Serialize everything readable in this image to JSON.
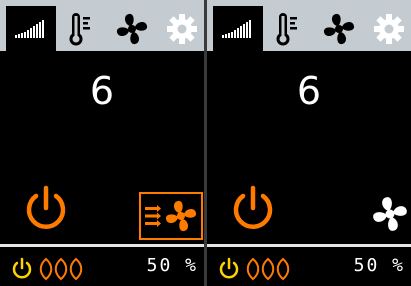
{
  "colors": {
    "accent": "#ff7b00",
    "status_yellow": "#ffd200",
    "tabbar_bg": "#c4ccd2",
    "screen_bg": "#000000"
  },
  "panels": [
    {
      "tabs": [
        {
          "icon": "signal-bars-icon",
          "active": true
        },
        {
          "icon": "thermometer-icon",
          "active": false
        },
        {
          "icon": "fan-icon",
          "active": false
        },
        {
          "icon": "gear-icon",
          "active": false
        }
      ],
      "value": "6",
      "mode_button_icon": "fan-airflow-icon",
      "status": {
        "power_icon": "power-icon",
        "heat_icon": "heat-waves-icon",
        "percent_value": "50",
        "percent_unit": "%"
      }
    },
    {
      "tabs": [
        {
          "icon": "signal-bars-icon",
          "active": true
        },
        {
          "icon": "thermometer-icon",
          "active": false
        },
        {
          "icon": "fan-icon",
          "active": false
        },
        {
          "icon": "gear-icon",
          "active": false
        }
      ],
      "value": "6",
      "mode_button_icon": "fan-icon",
      "status": {
        "power_icon": "power-icon",
        "heat_icon": "heat-waves-icon",
        "percent_value": "50",
        "percent_unit": "%"
      }
    }
  ]
}
